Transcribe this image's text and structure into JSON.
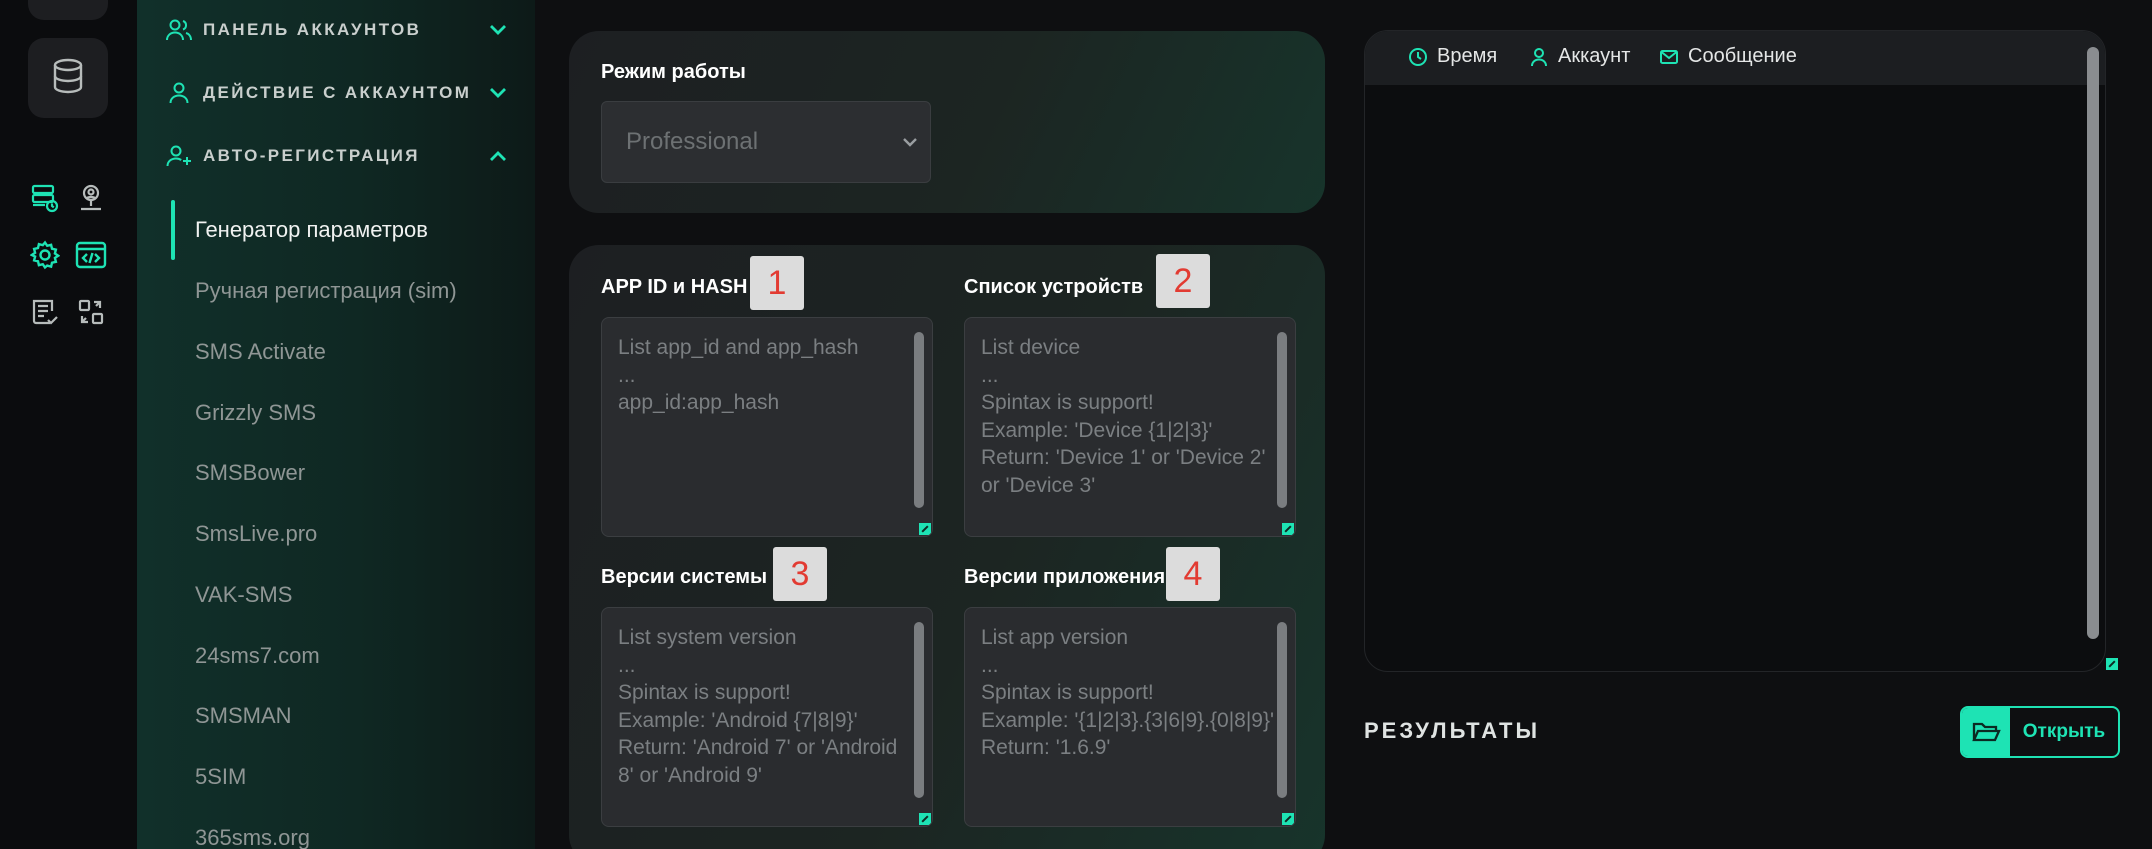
{
  "theme": {
    "accent": "#1ee3b4",
    "badge_text": "#e23b32"
  },
  "rail": {
    "icons": [
      "database-icon",
      "server-icon",
      "user-pin-icon",
      "gear-icon",
      "code-window-icon",
      "checklist-icon",
      "swap-icon"
    ]
  },
  "sidebar": {
    "sections": [
      {
        "label": "ПАНЕЛЬ АККАУНТОВ",
        "icon": "users-icon",
        "expanded": false
      },
      {
        "label": "ДЕЙСТВИЕ С АККАУНТОМ",
        "icon": "user-icon",
        "expanded": false
      },
      {
        "label": "АВТО-РЕГИСТРАЦИЯ",
        "icon": "user-plus-icon",
        "expanded": true
      }
    ],
    "items": [
      {
        "label": "Генератор параметров",
        "active": true
      },
      {
        "label": "Ручная регистрация (sim)",
        "active": false
      },
      {
        "label": "SMS Activate",
        "active": false
      },
      {
        "label": "Grizzly SMS",
        "active": false
      },
      {
        "label": "SMSBower",
        "active": false
      },
      {
        "label": "SmsLive.pro",
        "active": false
      },
      {
        "label": "VAK-SMS",
        "active": false
      },
      {
        "label": "24sms7.com",
        "active": false
      },
      {
        "label": "SMSMAN",
        "active": false
      },
      {
        "label": "5SIM",
        "active": false
      },
      {
        "label": "365sms.org",
        "active": false
      }
    ]
  },
  "mode": {
    "label": "Режим работы",
    "selected": "Professional"
  },
  "fields": {
    "app_id": {
      "label": "APP ID и HASH",
      "badge": "1",
      "placeholder": "List app_id and app_hash\n...\napp_id:app_hash"
    },
    "devices": {
      "label": "Список устройств",
      "badge": "2",
      "placeholder": "List device\n...\nSpintax is support!\nExample: 'Device {1|2|3}'\nReturn: 'Device 1' or 'Device 2' or 'Device 3'"
    },
    "system": {
      "label": "Версии системы",
      "badge": "3",
      "placeholder": "List system version\n...\nSpintax is support!\nExample: 'Android {7|8|9}'\nReturn: 'Android 7' or 'Android 8' or 'Android 9'"
    },
    "app_version": {
      "label": "Версии приложения",
      "badge": "4",
      "placeholder": "List app version\n...\nSpintax is support!\nExample: '{1|2|3}.{3|6|9}.{0|8|9}'\nReturn: '1.6.9'"
    }
  },
  "log": {
    "columns": [
      {
        "label": "Время",
        "icon": "clock-icon"
      },
      {
        "label": "Аккаунт",
        "icon": "user-icon"
      },
      {
        "label": "Сообщение",
        "icon": "mail-icon"
      }
    ]
  },
  "results": {
    "title": "РЕЗУЛЬТАТЫ",
    "open_label": "Открыть",
    "open_icon": "folder-open-icon"
  }
}
